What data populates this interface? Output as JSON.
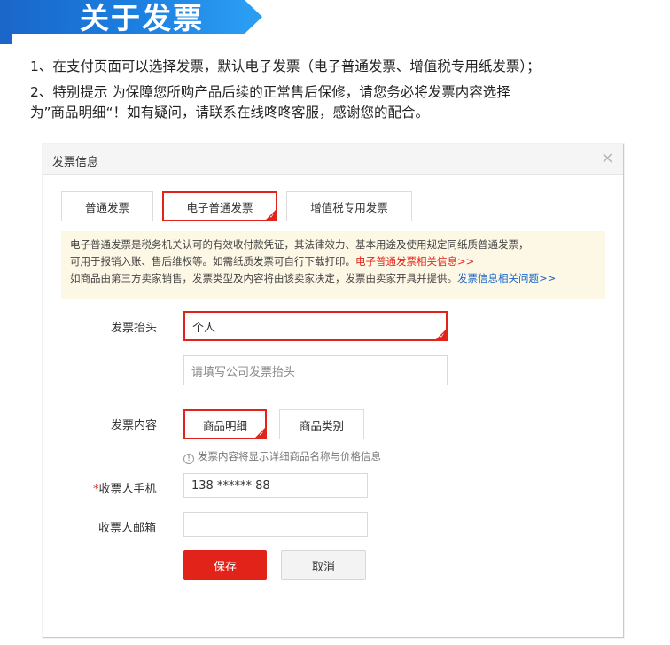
{
  "banner": {
    "title": "关于发票"
  },
  "intro": {
    "line1": "1、在支付页面可以选择发票，默认电子发票（电子普通发票、增值税专用纸发票）；",
    "line2": "2、特别提示 为保障您所购产品后续的正常售后保修，请您务必将发票内容选择",
    "line3": "为”商品明细“！如有疑问，请联系在线咚咚客服，感谢您的配合。"
  },
  "dialog": {
    "title": "发票信息",
    "close": "×",
    "tabs": [
      {
        "label": "普通发票",
        "selected": false
      },
      {
        "label": "电子普通发票",
        "selected": true
      },
      {
        "label": "增值税专用发票",
        "selected": false
      }
    ],
    "notice": {
      "line1": "电子普通发票是税务机关认可的有效收付款凭证，其法律效力、基本用途及使用规定同纸质普通发票，",
      "line2": "可用于报销入账、售后维权等。如需纸质发票可自行下载打印。",
      "line2_link": "电子普通发票相关信息>>",
      "line3": "如商品由第三方卖家销售，发票类型及内容将由该卖家决定，发票由卖家开具并提供。",
      "line3_link": "发票信息相关问题>>"
    },
    "invoice_header": {
      "label": "发票抬头",
      "selected_value": "个人",
      "company_placeholder": "请填写公司发票抬头"
    },
    "invoice_content": {
      "label": "发票内容",
      "options": [
        {
          "label": "商品明细",
          "selected": true
        },
        {
          "label": "商品类别",
          "selected": false
        }
      ],
      "hint": "发票内容将显示详细商品名称与价格信息"
    },
    "phone": {
      "required_mark": "*",
      "label": "收票人手机",
      "value": "138 ****** 88"
    },
    "email": {
      "label": "收票人邮箱",
      "value": ""
    },
    "actions": {
      "save": "保存",
      "cancel": "取消"
    }
  },
  "colors": {
    "brand_blue": "#1a66c9",
    "accent_red": "#e2231a",
    "notice_bg": "#fdf8e6"
  }
}
